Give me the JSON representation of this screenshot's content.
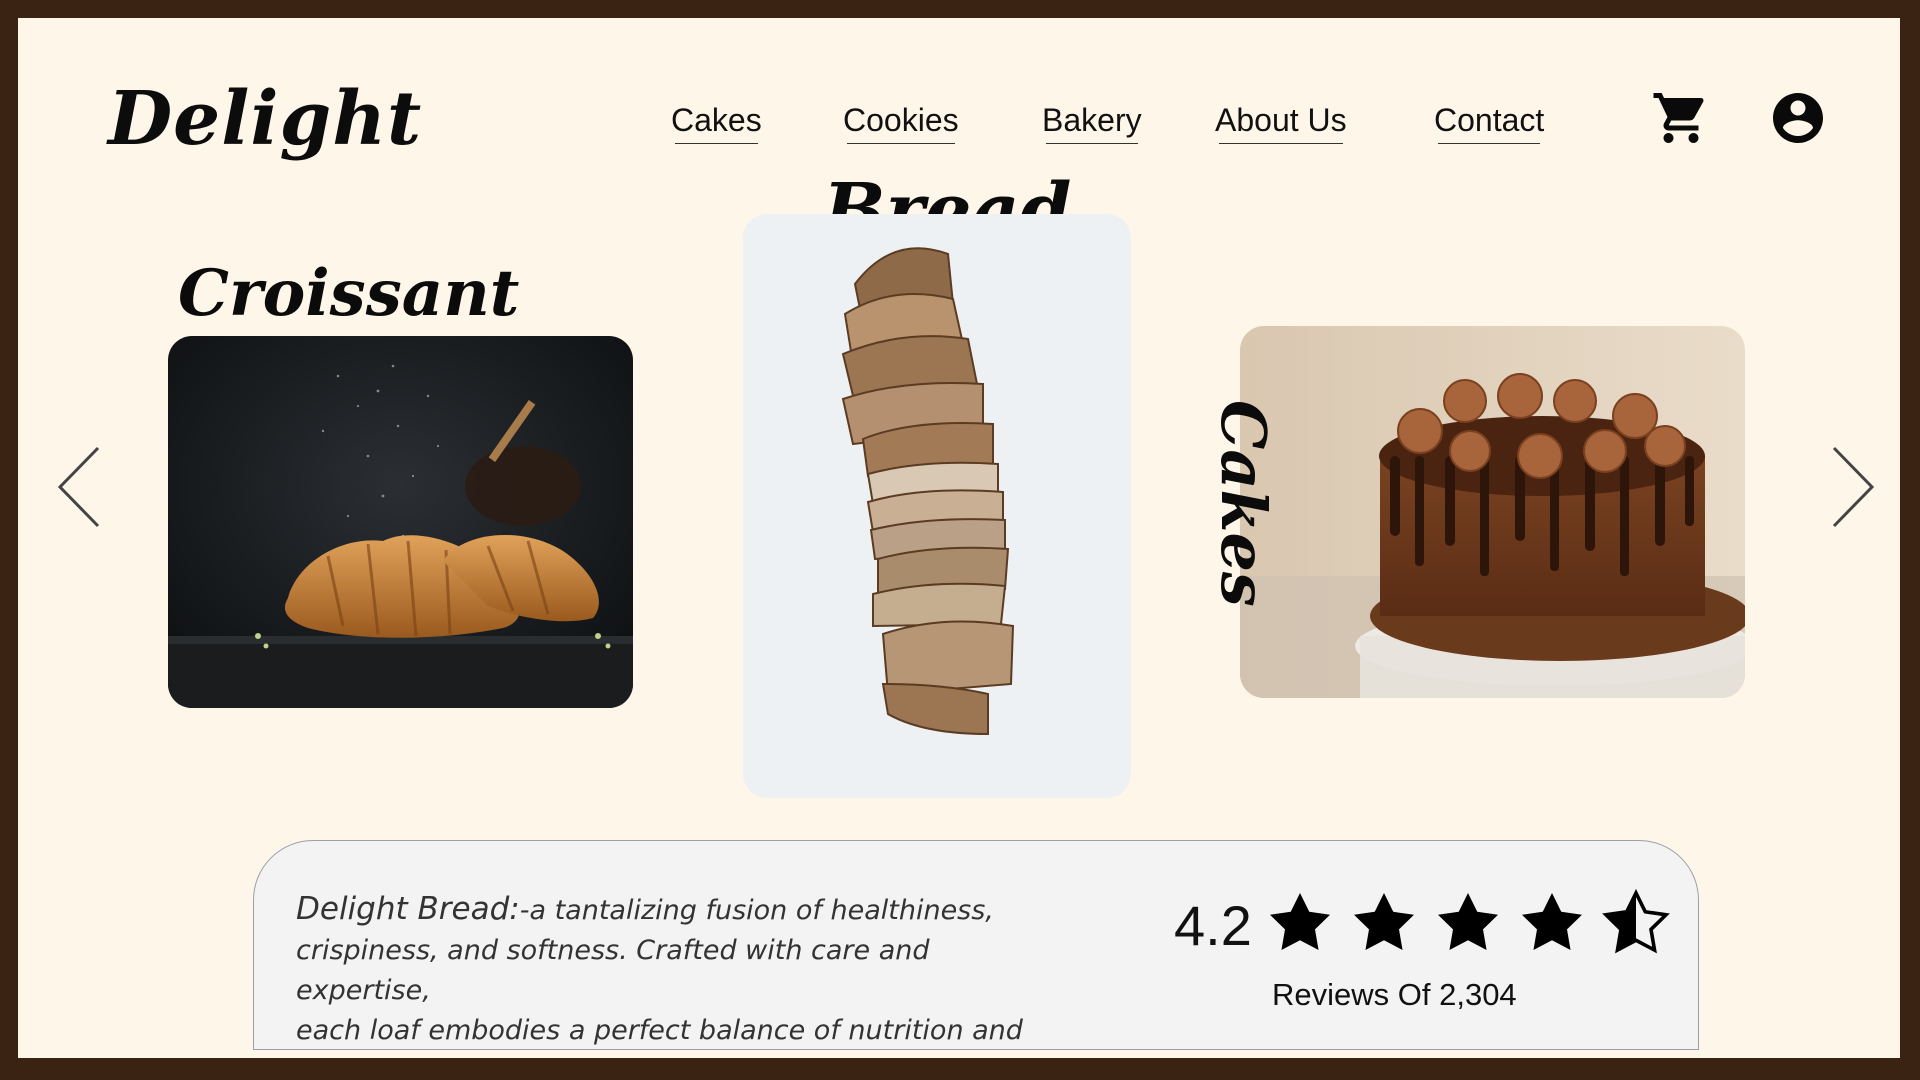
{
  "brand": {
    "logo": "Delight"
  },
  "nav": {
    "items": [
      {
        "label": "Cakes"
      },
      {
        "label": "Cookies"
      },
      {
        "label": "Bakery"
      },
      {
        "label": "About Us"
      },
      {
        "label": "Contact"
      }
    ],
    "icons": [
      "cart-icon",
      "account-icon"
    ]
  },
  "carousel": {
    "prev_icon": "chevron-left-icon",
    "next_icon": "chevron-right-icon",
    "cards": [
      {
        "title": "Croissant"
      },
      {
        "title": "Bread"
      },
      {
        "title": "Cakes"
      }
    ]
  },
  "info": {
    "brand_label": "Delight Bread:",
    "description": "-a tantalizing fusion of healthiness,\n crispiness, and softness. Crafted with care and expertise,\neach loaf embodies a perfect balance of nutrition and flavor.",
    "rating": "4.2",
    "rating_stars": 4.5,
    "reviews": "Reviews Of 2,304"
  },
  "colors": {
    "border": "#3b2314",
    "background": "#fff6ea",
    "panel": "#f3f3f3",
    "text": "#111111"
  }
}
